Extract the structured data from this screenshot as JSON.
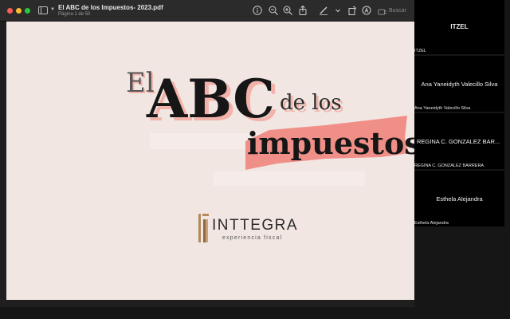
{
  "window": {
    "title": "El ABC de los Impuestos- 2023.pdf",
    "page_indicator": "Página 1 de 50"
  },
  "toolbar": {
    "icons": [
      "info-icon",
      "zoom-out-icon",
      "zoom-in-icon",
      "share-icon",
      "markup-pen-icon",
      "chevron-down-icon",
      "rotate-icon",
      "annotate-circle-icon",
      "sidebar-swap-icon",
      "search-icon"
    ],
    "search_placeholder": "Buscar"
  },
  "slide": {
    "title_el": "El",
    "title_abc": "ABC",
    "title_de_los": "de los",
    "title_impuestos": "impuestos",
    "logo_name": "INTTEGRA",
    "logo_tagline": "experiencia fiscal",
    "colors": {
      "background": "#f1e6e2",
      "brush": "#f08f87",
      "ink": "#161616",
      "gold": "#b28a5c"
    }
  },
  "participants": [
    {
      "name": "ITZEL",
      "label": "ITZEL"
    },
    {
      "name": "Ana Yaneidyth Valecillo Silva",
      "label": "Ana Yaneidyth Valecillo Silva"
    },
    {
      "name": "REGINA C. GONZALEZ BAR...",
      "label": "REGINA C. GONZALEZ BARRERA"
    },
    {
      "name": "Esthela Alejandra",
      "label": "Esthela Alejandra"
    }
  ]
}
